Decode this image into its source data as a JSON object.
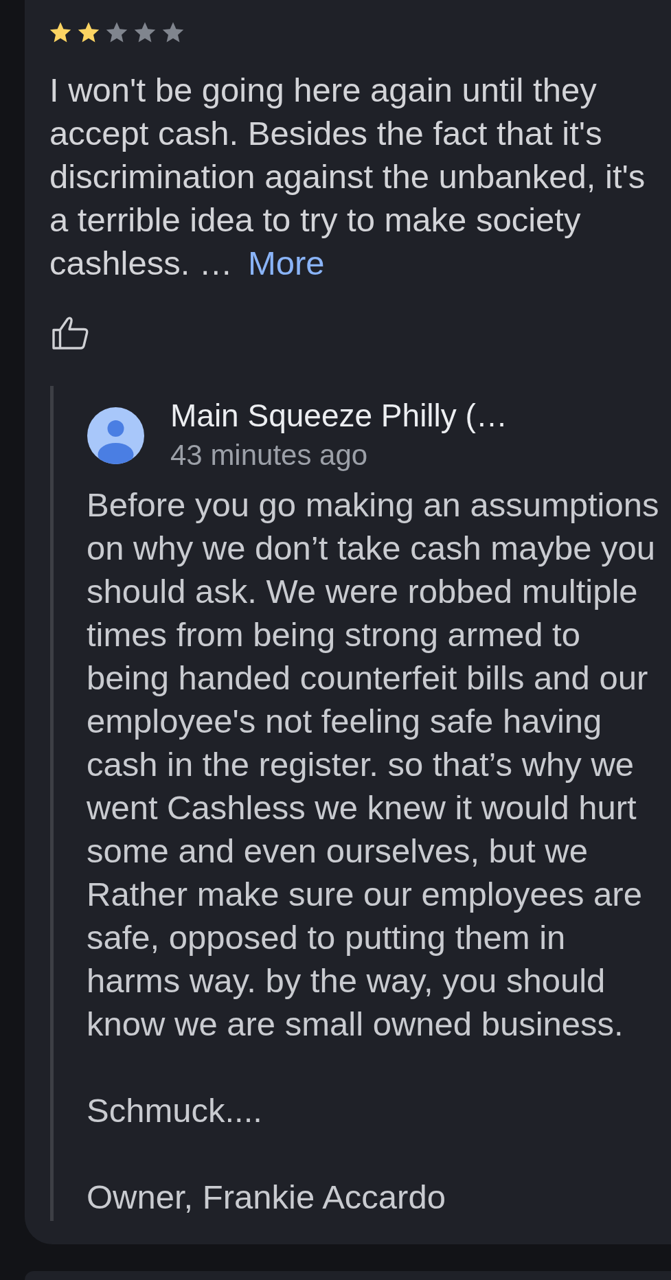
{
  "review": {
    "stars": 2,
    "text": "I won't be going here again until they\naccept cash. Besides the fact that it's\ndiscrimination against the unbanked, it's\na terrible idea to try to make society\ncashless. …",
    "more_link": "More"
  },
  "owner_reply": {
    "name": "Main Squeeze Philly (…",
    "time": "43 minutes ago",
    "text": "Before you go making an assumptions\non why we don’t take cash maybe you\nshould ask. We were robbed multiple\ntimes from being strong armed to\nbeing handed counterfeit bills and our\nemployee's not feeling safe having\ncash in the register. so that’s why we\nwent Cashless we knew it would hurt\nsome and even ourselves, but we\nRather make sure our employees are\nsafe, opposed to putting them in\nharms way. by the way, you should\nknow we are small owned business.\n\nSchmuck....\n\nOwner, Frankie Accardo"
  }
}
